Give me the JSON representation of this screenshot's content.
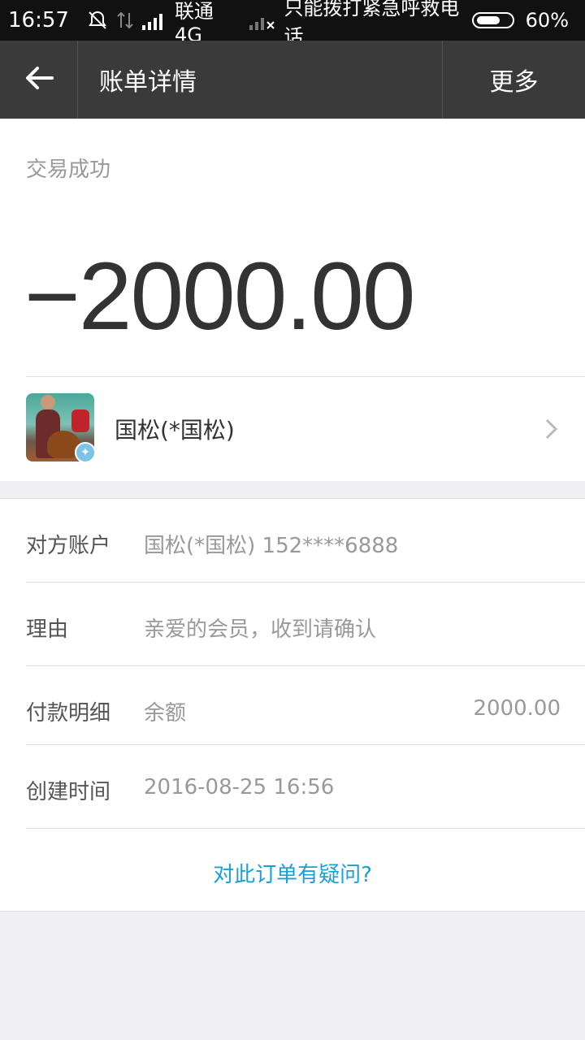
{
  "status_bar": {
    "time": "16:57",
    "carrier": "联通 4G",
    "emergency_text": "只能拨打紧急呼救电话",
    "battery": "60%"
  },
  "nav": {
    "title": "账单详情",
    "more_label": "更多"
  },
  "transaction": {
    "status": "交易成功",
    "amount": "−2000.00",
    "payee_name": "国松(*国松)"
  },
  "details": {
    "rows": [
      {
        "label": "对方账户",
        "value": "国松(*国松) 152****6888"
      },
      {
        "label": "理由",
        "value": "亲爱的会员，收到请确认"
      },
      {
        "label": "付款明细",
        "value": "余额",
        "amount": "2000.00"
      },
      {
        "label": "创建时间",
        "value": "2016-08-25 16:56"
      }
    ],
    "question_link": "对此订单有疑问?"
  },
  "colors": {
    "nav_bg": "#3a3a3a",
    "link": "#1aa0d8",
    "badge": "#7cc3e8"
  }
}
